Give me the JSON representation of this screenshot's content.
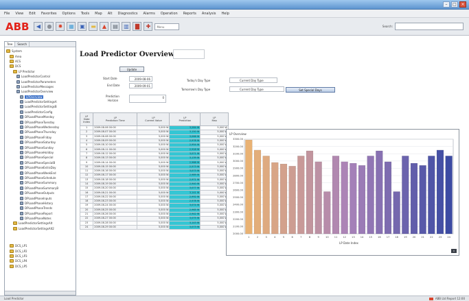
{
  "window": {
    "buttons": [
      {
        "icon": "minimize-icon",
        "glyph": "–"
      },
      {
        "icon": "maximize-icon",
        "glyph": "□"
      },
      {
        "icon": "close-icon",
        "glyph": "×"
      }
    ]
  },
  "menu": {
    "items": [
      "File",
      "View",
      "Edit",
      "Favorites",
      "Options",
      "Tools",
      "Map",
      "Alt",
      "Diagnostics",
      "Alarms",
      "Operation",
      "Reports",
      "Analysis",
      "Help"
    ]
  },
  "toolbar": {
    "logo_text": "ABB",
    "logo_color": "#e2231a",
    "buttons": [
      {
        "icon": "back-icon",
        "glyph": "◀",
        "color": "#3a62b6"
      },
      {
        "icon": "stop-icon",
        "glyph": "●",
        "color": "#8b9098"
      },
      {
        "icon": "alarm-icon",
        "glyph": "✹",
        "color": "#d9442c"
      },
      {
        "icon": "grid-icon",
        "glyph": "▦",
        "color": "#4aa0d6"
      },
      {
        "icon": "window-icon",
        "glyph": "▣",
        "color": "#3a62b6"
      },
      {
        "icon": "folder-icon",
        "glyph": "▬",
        "color": "#e3b944"
      },
      {
        "icon": "trend-icon",
        "glyph": "▲",
        "color": "#d9442c"
      },
      {
        "icon": "print-icon",
        "glyph": "▤",
        "color": "#5b6470"
      },
      {
        "icon": "report-icon",
        "glyph": "▥",
        "color": "#3a62b6"
      },
      {
        "icon": "chart-icon",
        "glyph": "▇",
        "color": "#c0392b"
      },
      {
        "icon": "pin-icon",
        "glyph": "✚",
        "color": "#c0392b"
      }
    ],
    "combo_value": "Menu",
    "search_label": "Search:"
  },
  "sidebar": {
    "tabs": [
      "Tree",
      "Search"
    ],
    "items": [
      {
        "label": "System",
        "kind": "folder",
        "indent": 0
      },
      {
        "label": "Area",
        "kind": "folder",
        "indent": 1
      },
      {
        "label": "ACS",
        "kind": "folder",
        "indent": 1
      },
      {
        "label": "DCS",
        "kind": "folder",
        "indent": 1
      },
      {
        "label": "LP Predictor",
        "kind": "folder",
        "indent": 2
      },
      {
        "label": "LoadPredictorControl",
        "kind": "obj",
        "indent": 3
      },
      {
        "label": "LoadPredictorParameters",
        "kind": "obj",
        "indent": 3
      },
      {
        "label": "LoadPredictorMessages",
        "kind": "obj",
        "indent": 3
      },
      {
        "label": "LoadPredictorOverview",
        "kind": "obj",
        "indent": 3
      },
      {
        "label": "LPOverview",
        "kind": "obj",
        "indent": 4,
        "selected": true
      },
      {
        "label": "LoadPredictorSettingsA",
        "kind": "obj",
        "indent": 4
      },
      {
        "label": "LoadPredictorSettingsB",
        "kind": "obj",
        "indent": 4
      },
      {
        "label": "LoadPredictorConfig",
        "kind": "obj",
        "indent": 4
      },
      {
        "label": "DPLoadPhaseMonday",
        "kind": "obj",
        "indent": 4
      },
      {
        "label": "DPLoadPhaseTuesday",
        "kind": "obj",
        "indent": 4
      },
      {
        "label": "DPLoadPhaseWednesday",
        "kind": "obj",
        "indent": 4
      },
      {
        "label": "DPLoadPhaseThursday",
        "kind": "obj",
        "indent": 4
      },
      {
        "label": "DPLoadPhaseFriday",
        "kind": "obj",
        "indent": 4
      },
      {
        "label": "DPLoadPhaseSaturday",
        "kind": "obj",
        "indent": 4
      },
      {
        "label": "DPLoadPhaseSunday",
        "kind": "obj",
        "indent": 4
      },
      {
        "label": "DPLoadPhaseHoliday",
        "kind": "obj",
        "indent": 4
      },
      {
        "label": "DPLoadPhaseSpecial",
        "kind": "obj",
        "indent": 4
      },
      {
        "label": "DPLoadPhaseSpecialB",
        "kind": "obj",
        "indent": 4
      },
      {
        "label": "DPLoadPhaseExtraDay",
        "kind": "obj",
        "indent": 4
      },
      {
        "label": "DPLoadPhaseWeekEnd",
        "kind": "obj",
        "indent": 4
      },
      {
        "label": "DPLoadPhaseSchedule",
        "kind": "obj",
        "indent": 4
      },
      {
        "label": "DPLoadPhaseSummary",
        "kind": "obj",
        "indent": 4
      },
      {
        "label": "DPLoadPhaseSummaryB",
        "kind": "obj",
        "indent": 4
      },
      {
        "label": "DPLoadPhaseOutputs",
        "kind": "obj",
        "indent": 4
      },
      {
        "label": "DPLoadPhaseInputs",
        "kind": "obj",
        "indent": 4
      },
      {
        "label": "DPLoadPhaseHistory",
        "kind": "obj",
        "indent": 4
      },
      {
        "label": "DPLoadPhaseTrends",
        "kind": "obj",
        "indent": 4
      },
      {
        "label": "DPLoadPhaseReport",
        "kind": "obj",
        "indent": 4
      },
      {
        "label": "DPLoadPhaseNotes",
        "kind": "obj",
        "indent": 4
      },
      {
        "label": "LoadPredictorSettingsAlt",
        "kind": "folder",
        "indent": 2
      },
      {
        "label": "LoadPredictorSettingsAlt2",
        "kind": "folder",
        "indent": 2
      },
      {
        "label": "DCS_LP1",
        "kind": "folder",
        "indent": 1,
        "gap": true
      },
      {
        "label": "DCS_LP2",
        "kind": "folder",
        "indent": 1
      },
      {
        "label": "DCS_LP3",
        "kind": "folder",
        "indent": 1
      },
      {
        "label": "DCS_LP4",
        "kind": "folder",
        "indent": 1
      },
      {
        "label": "DCS_LP5",
        "kind": "folder",
        "indent": 1
      }
    ]
  },
  "page": {
    "title": "Load Predictor Overview",
    "update_label": "Update",
    "fields": {
      "start_label": "Start Date",
      "start_value": "2009-08-06",
      "end_label": "End Date",
      "end_value": "2009-09-01",
      "mode_label": "Prediction",
      "mode_label2": "Horizon",
      "mode_value": "0",
      "daytype_label": "Today's Day Type",
      "daytype_value": "Current Day Type",
      "tomorrow_label": "Tomorrow's Day Type",
      "tomorrow_value": "Current Day Type",
      "special_label": "Set Special Days"
    }
  },
  "table": {
    "headers": [
      "LP\nDate Index",
      "LP\nPrediction Time",
      "LP\nCurrent Value",
      "LP\nPrediction",
      "LP\nMax"
    ],
    "rows": [
      [
        "1",
        "2009-08-06 00:00",
        "5,000 W",
        "3,284 W",
        "5,000 W"
      ],
      [
        "2",
        "2009-08-07 00:00",
        "5,000 W",
        "3,150 W",
        "5,000 W"
      ],
      [
        "3",
        "2009-08-08 00:00",
        "5,000 W",
        "3,066 W",
        "5,000 W"
      ],
      [
        "4",
        "2009-08-09 00:00",
        "5,000 W",
        "2,978 W",
        "5,000 W"
      ],
      [
        "5",
        "2009-08-10 00:00",
        "5,000 W",
        "2,954 W",
        "5,000 W"
      ],
      [
        "6",
        "2009-08-11 00:00",
        "5,000 W",
        "2,928 W",
        "5,000 W"
      ],
      [
        "7",
        "2009-08-12 00:00",
        "5,000 W",
        "3,071 W",
        "5,000 W"
      ],
      [
        "8",
        "2009-08-13 00:00",
        "5,000 W",
        "3,139 W",
        "5,000 W"
      ],
      [
        "9",
        "2009-08-14 00:00",
        "5,000 W",
        "2,988 W",
        "5,000 W"
      ],
      [
        "10",
        "2009-08-15 00:00",
        "5,000 W",
        "2,573 W",
        "5,000 W"
      ],
      [
        "11",
        "2009-08-16 00:00",
        "5,000 W",
        "3,073 W",
        "5,000 W"
      ],
      [
        "12",
        "2009-08-17 00:00",
        "5,000 W",
        "2,989 W",
        "5,000 W"
      ],
      [
        "13",
        "2009-08-18 00:00",
        "5,000 W",
        "2,971 W",
        "5,000 W"
      ],
      [
        "14",
        "2009-08-19 00:00",
        "5,000 W",
        "2,940 W",
        "5,000 W"
      ],
      [
        "15",
        "2009-08-20 00:00",
        "5,000 W",
        "3,077 W",
        "5,000 W"
      ],
      [
        "16",
        "2009-08-21 00:00",
        "5,000 W",
        "3,141 W",
        "5,000 W"
      ],
      [
        "17",
        "2009-08-22 00:00",
        "5,000 W",
        "2,992 W",
        "5,000 W"
      ],
      [
        "18",
        "2009-08-23 00:00",
        "5,000 W",
        "2,578 W",
        "5,000 W"
      ],
      [
        "19",
        "2009-08-24 00:00",
        "5,000 W",
        "3,074 W",
        "5,000 W"
      ],
      [
        "20",
        "2009-08-25 00:00",
        "5,000 W",
        "2,965 W",
        "5,000 W"
      ],
      [
        "21",
        "2009-08-26 00:00",
        "5,000 W",
        "2,942 W",
        "5,000 W"
      ],
      [
        "22",
        "2009-08-27 00:00",
        "5,000 W",
        "3,075 W",
        "5,000 W"
      ],
      [
        "23",
        "2009-08-28 00:00",
        "5,000 W",
        "3,143 W",
        "5,000 W"
      ],
      [
        "24",
        "2009-08-29 00:00",
        "5,000 W",
        "3,073 W",
        "5,000 W"
      ]
    ]
  },
  "chart_data": {
    "type": "bar",
    "title": "LP Overview",
    "xlabel": "LP Date Index",
    "ylabel": "",
    "categories": [
      "1",
      "2",
      "3",
      "4",
      "5",
      "6",
      "7",
      "8",
      "9",
      "10",
      "11",
      "12",
      "13",
      "14",
      "15",
      "16",
      "17",
      "18",
      "19",
      "20",
      "21",
      "22",
      "23",
      "24"
    ],
    "values": [
      3290,
      3150,
      3070,
      2980,
      2960,
      2930,
      3070,
      3140,
      2990,
      2580,
      3070,
      2990,
      2970,
      2940,
      3070,
      3140,
      2990,
      2580,
      3070,
      2970,
      2940,
      3070,
      3150,
      3070
    ],
    "ylim": [
      2000,
      3300
    ],
    "yticks": [
      2000,
      2100,
      2200,
      2300,
      2400,
      2500,
      2600,
      2700,
      2800,
      2900,
      3000,
      3100,
      3200,
      3300
    ],
    "grid": true,
    "colors": {
      "start": "#e9b274",
      "mid": "#a982b9",
      "end": "#3c4ba3"
    }
  },
  "status": {
    "left": "Load Predictor",
    "right": "ABB Ltd  Report  12:00"
  }
}
